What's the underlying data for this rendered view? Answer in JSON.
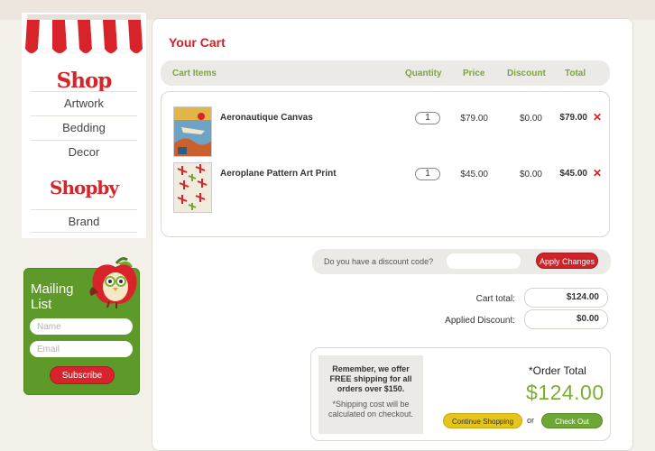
{
  "sidebar": {
    "shop_title": "Shop",
    "categories": [
      {
        "label": "Artwork"
      },
      {
        "label": "Bedding"
      },
      {
        "label": "Decor"
      }
    ],
    "shopby_title": "Shopby",
    "brand_label": "Brand"
  },
  "mailing": {
    "title": "Mailing List",
    "name_placeholder": "Name",
    "email_placeholder": "Email",
    "subscribe_label": "Subscribe"
  },
  "cart": {
    "title": "Your Cart",
    "columns": {
      "items": "Cart Items",
      "quantity": "Quantity",
      "price": "Price",
      "discount": "Discount",
      "total": "Total"
    },
    "items": [
      {
        "name": "Aeronautique Canvas",
        "quantity": "1",
        "price": "$79.00",
        "discount": "$0.00",
        "total": "$79.00"
      },
      {
        "name": "Aeroplane Pattern Art Print",
        "quantity": "1",
        "price": "$45.00",
        "discount": "$0.00",
        "total": "$45.00"
      }
    ],
    "remove_glyph": "✕"
  },
  "discount": {
    "prompt": "Do you have a discount code?",
    "code_value": "",
    "apply_label": "Apply Changes"
  },
  "summary": {
    "cart_total_label": "Cart total:",
    "cart_total": "$124.00",
    "applied_discount_label": "Applied Discount:",
    "applied_discount": "$0.00"
  },
  "order": {
    "shipping_note": "Remember, we offer FREE shipping for all orders over $150.",
    "shipping_sub": "*Shipping cost will be calculated on checkout.",
    "total_label": "*Order Total",
    "total_amount": "$124.00",
    "continue_label": "Continue Shopping",
    "or_text": "or",
    "checkout_label": "Check Out"
  },
  "colors": {
    "brand_red": "#d51e27",
    "accent_green": "#7aaf2f",
    "mailing_green": "#5e9a2a",
    "continue_yellow": "#e5c51b"
  },
  "icons": {
    "awning": "striped-awning-icon",
    "apple_mascot": "apple-owl-icon",
    "remove": "close-icon"
  }
}
